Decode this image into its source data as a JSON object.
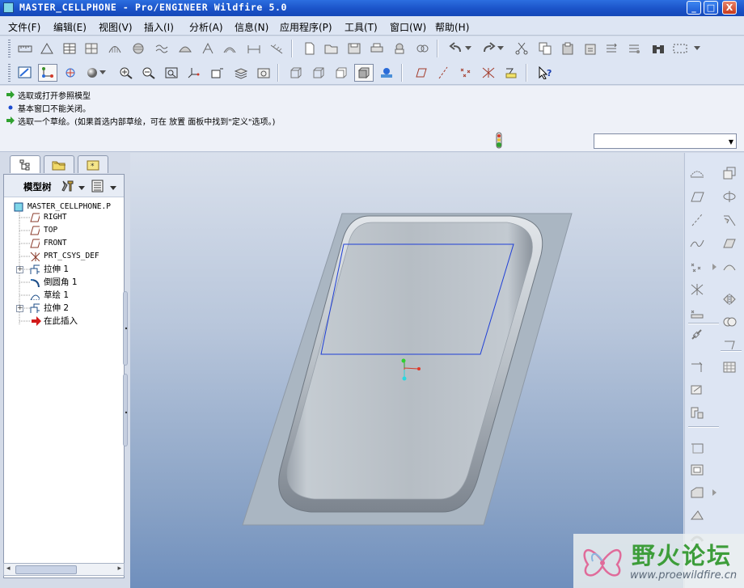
{
  "window": {
    "title": "MASTER_CELLPHONE - Pro/ENGINEER Wildfire 5.0",
    "minimize_glyph": "_",
    "maximize_glyph": "□",
    "close_glyph": "X"
  },
  "menu": {
    "items": [
      "文件(F)",
      "编辑(E)",
      "视图(V)",
      "插入(I)",
      "分析(A)",
      "信息(N)",
      "应用程序(P)",
      "工具(T)",
      "窗口(W)",
      "帮助(H)"
    ]
  },
  "messages": [
    {
      "icon": "green-arrow-icon",
      "text": "选取或打开参照模型"
    },
    {
      "icon": "info-bullet-icon",
      "text": "基本窗口不能关闭。"
    },
    {
      "icon": "green-arrow-icon",
      "text": "选取一个草绘。(如果首选内部草绘，可在 放置 面板中找到\"定义\"选项。)"
    }
  ],
  "navigator": {
    "tree_label": "模型树",
    "tree_items": [
      {
        "label": "MASTER_CELLPHONE.P",
        "icon": "part-icon",
        "level": 0,
        "expandable": false
      },
      {
        "label": "RIGHT",
        "icon": "datum-plane-icon",
        "level": 1,
        "expandable": false
      },
      {
        "label": "TOP",
        "icon": "datum-plane-icon",
        "level": 1,
        "expandable": false
      },
      {
        "label": "FRONT",
        "icon": "datum-plane-icon",
        "level": 1,
        "expandable": false
      },
      {
        "label": "PRT_CSYS_DEF",
        "icon": "csys-icon",
        "level": 1,
        "expandable": false
      },
      {
        "label": "拉伸 1",
        "icon": "extrude-icon",
        "level": 1,
        "expandable": true
      },
      {
        "label": "倒圆角 1",
        "icon": "round-icon",
        "level": 1,
        "expandable": false
      },
      {
        "label": "草绘 1",
        "icon": "sketch-icon",
        "level": 1,
        "expandable": false
      },
      {
        "label": "拉伸 2",
        "icon": "extrude-icon",
        "level": 1,
        "expandable": true
      },
      {
        "label": "在此插入",
        "icon": "insert-here-arrow-icon",
        "level": 1,
        "expandable": false
      }
    ]
  },
  "watermark": {
    "text": "野火论坛",
    "url": "www.proewildfire.cn"
  },
  "colors": {
    "title_bar": "#1b53c8",
    "sketch_outline": "#1f3fd6",
    "brand_green": "#3d9d3a",
    "model_gray": "#b4bbc2"
  }
}
